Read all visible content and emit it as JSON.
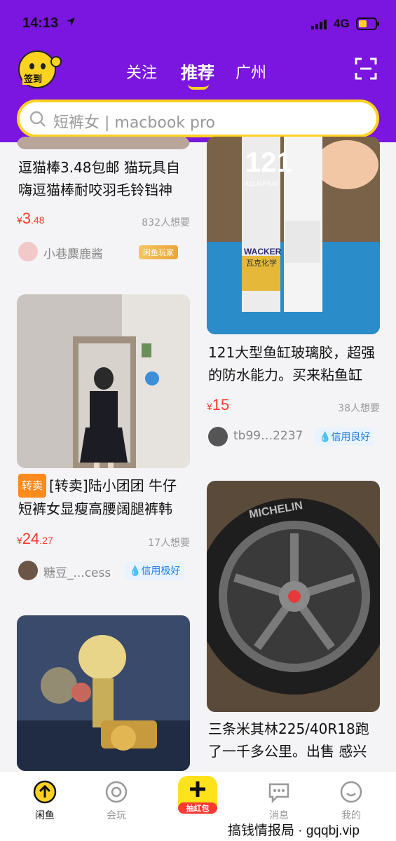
{
  "status_bar": {
    "time": "14:13",
    "network": "4G"
  },
  "header": {
    "signin_label": "签到",
    "tabs": [
      {
        "label": "关注",
        "active": false
      },
      {
        "label": "推荐",
        "active": true
      },
      {
        "label": "广州",
        "active": false
      }
    ],
    "search_placeholder": "短裤女 | macbook pro"
  },
  "colors": {
    "brand_purple": "#7a16e0",
    "accent_yellow": "#ffd21f",
    "price_red": "#ff3a30",
    "badge_blue": "#1a7ae8"
  },
  "feed": {
    "left": [
      {
        "title": "逗猫棒3.48包邮 猫玩具自嗨逗猫棒耐咬羽毛铃铛神",
        "price_currency": "¥",
        "price_int": "3",
        "price_dec": ".48",
        "wants": "832人想要",
        "seller": "小巷麋鹿酱",
        "badge": "闲鱼玩家"
      },
      {
        "tag": "转卖",
        "title": "[转卖]陆小团团 牛仔短裤女显瘦高腰阔腿裤韩",
        "price_currency": "¥",
        "price_int": "24",
        "price_dec": ".27",
        "wants": "17人想要",
        "seller": "糖豆_...cess",
        "badge": "信用极好"
      },
      {
        "title": ""
      }
    ],
    "right": [
      {
        "title": "121大型鱼缸玻璃胶，超强的防水能力。买来粘鱼缸",
        "image_text": {
          "big": "121",
          "sub": "AQUARIUM",
          "brand": "WACKER",
          "brand_cn": "瓦克化学"
        },
        "price_currency": "¥",
        "price_int": "15",
        "price_dec": "",
        "wants": "38人想要",
        "seller": "tb99…2237",
        "badge": "信用良好"
      },
      {
        "title": "三条米其林225/40R18跑了一千多公里。出售 感兴",
        "image_text": {
          "tire_brand": "MICHELIN"
        }
      }
    ]
  },
  "bottom_nav": {
    "items": [
      {
        "label": "闲鱼",
        "icon": "arrow-up-circle-icon",
        "active": true
      },
      {
        "label": "会玩",
        "icon": "ring-icon",
        "active": false
      },
      {
        "label": "抽红包",
        "icon": "plus-icon",
        "active": false
      },
      {
        "label": "消息",
        "icon": "chat-bubble-icon",
        "active": false
      },
      {
        "label": "我的",
        "icon": "smile-icon",
        "active": false
      }
    ]
  },
  "watermark": "搞钱情报局 · gqqbj.vip"
}
